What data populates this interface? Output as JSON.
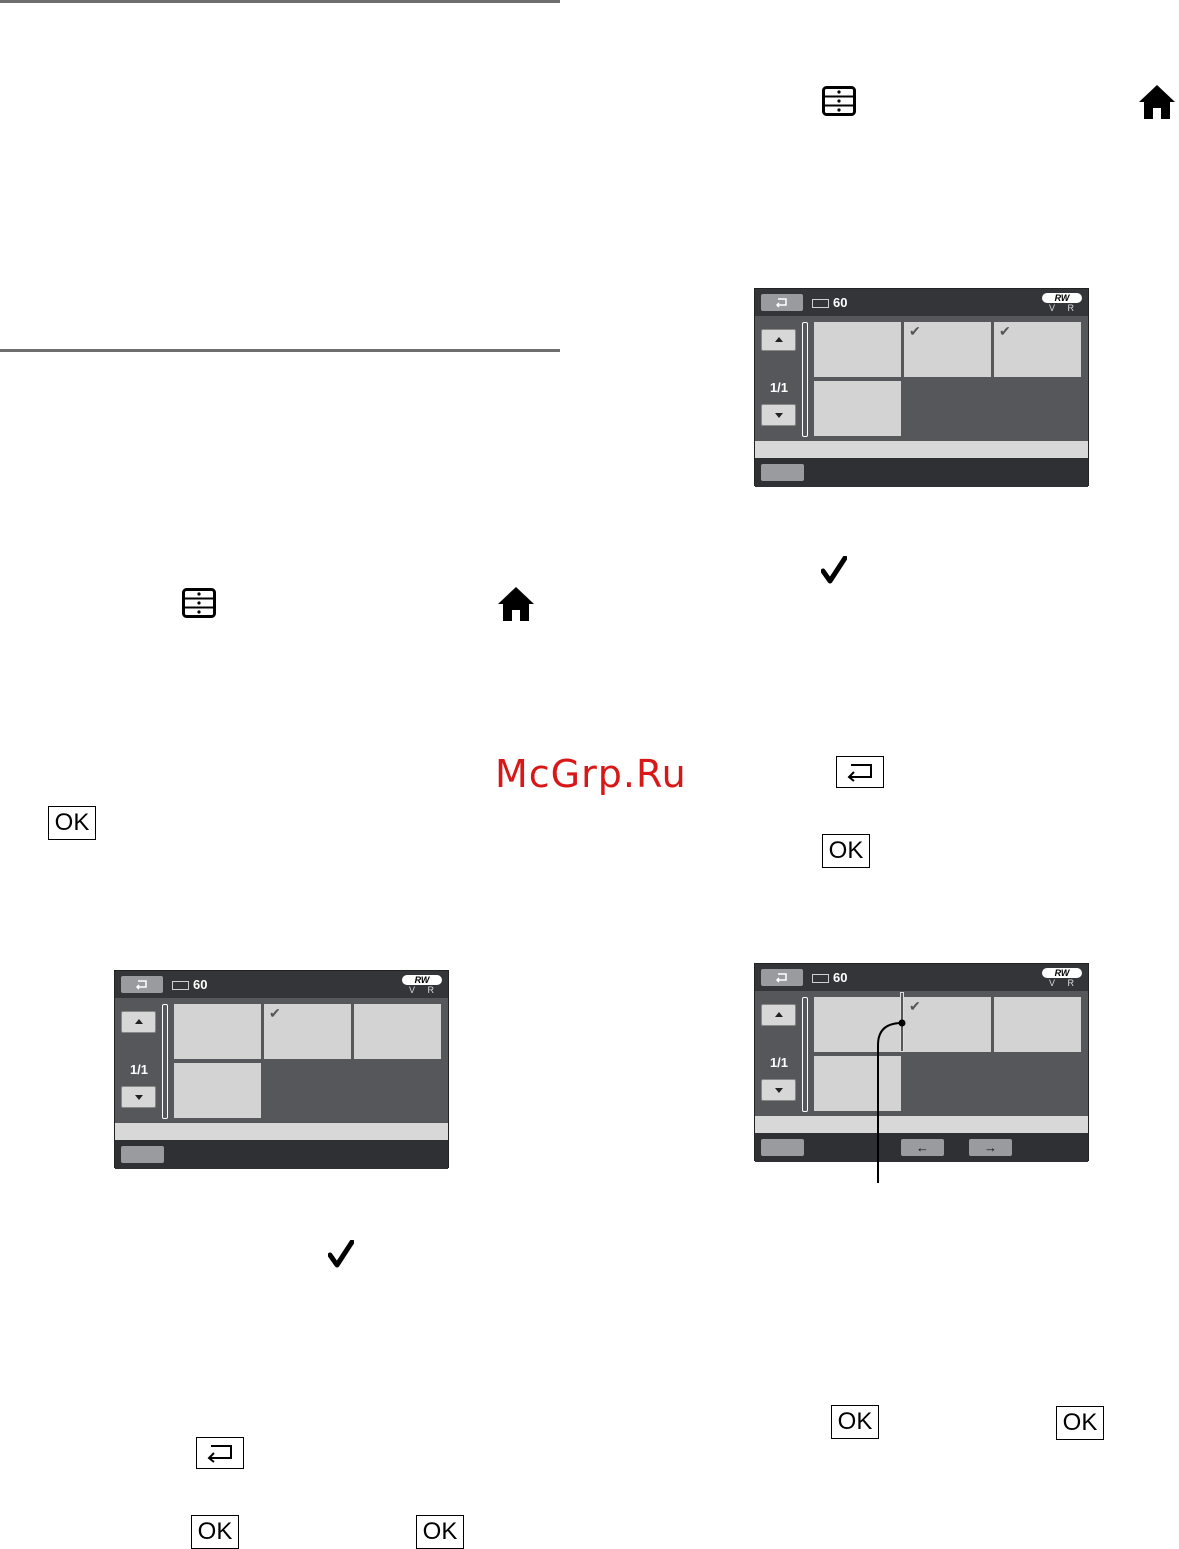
{
  "page": {
    "watermark": "McGrp.Ru",
    "ok_label": "OK",
    "checkmark": "✔"
  },
  "screens": [
    {
      "battery": "60",
      "rw_logo": "RW",
      "rw_sub": "V R",
      "page": "1/1",
      "checked_thumbs": [
        1
      ],
      "arrows": false
    },
    {
      "battery": "60",
      "rw_logo": "RW",
      "rw_sub": "V R",
      "page": "1/1",
      "checked_thumbs": [
        1,
        2
      ],
      "arrows": false
    },
    {
      "battery": "60",
      "rw_logo": "RW",
      "rw_sub": "V R",
      "page": "1/1",
      "checked_thumbs": [
        1
      ],
      "arrows": true,
      "prev_arrow": "←",
      "next_arrow": "→"
    }
  ],
  "colors": {
    "watermark": "#d81818",
    "screen_bg": "#55575b",
    "thumb": "#d3d3d3"
  }
}
